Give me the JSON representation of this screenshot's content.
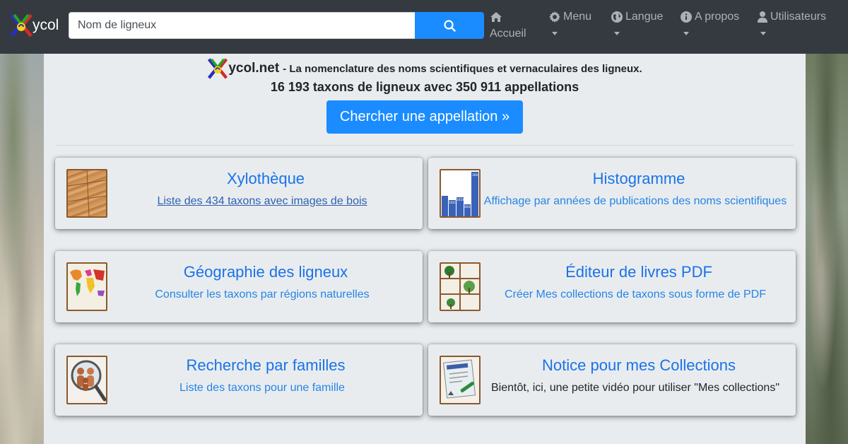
{
  "navbar": {
    "brand_text": "ycol",
    "search_placeholder": "Nom de ligneux",
    "items": [
      {
        "label": "Accueil",
        "icon": "home-icon"
      },
      {
        "label": "Menu",
        "icon": "gear-icon"
      },
      {
        "label": "Langue",
        "icon": "globe-icon"
      },
      {
        "label": "A propos",
        "icon": "info-icon"
      },
      {
        "label": "Utilisateurs",
        "icon": "user-icon"
      }
    ]
  },
  "header": {
    "site_name": "ycol.net",
    "description": "- La nomenclature des noms scientifiques et vernaculaires des ligneux.",
    "stats": "16 193 taxons de ligneux avec 350 911 appellations",
    "cta_label": "Chercher une appellation »"
  },
  "cards": [
    {
      "title": "Xylothèque",
      "text": "Liste des 434 taxons avec images de bois",
      "thumb": "wood-planks-image"
    },
    {
      "title": "Histogramme",
      "text": "Affichage par années de publications des noms scientifiques",
      "thumb": "histogram-image",
      "bar_labels": [
        "3602",
        "1656",
        "1641",
        "464"
      ]
    },
    {
      "title": "Géographie des ligneux",
      "text": "Consulter les taxons par régions naturelles",
      "thumb": "world-map-image"
    },
    {
      "title": "Éditeur de livres PDF",
      "text": "Créer Mes collections de taxons sous forme de PDF",
      "thumb": "tree-bookshelf-image"
    },
    {
      "title": "Recherche par familles",
      "text": "Liste des taxons pour une famille",
      "thumb": "family-magnifier-image"
    },
    {
      "title": "Notice pour mes Collections",
      "text": "Bientôt, ici, une petite vidéo pour utiliser \"Mes collections\"",
      "thumb": "instruction-manual-image"
    }
  ],
  "colors": {
    "navbar_bg": "#343a40",
    "primary": "#1a8cff",
    "link": "#1a73e8",
    "content_bg": "#e9ecef"
  }
}
